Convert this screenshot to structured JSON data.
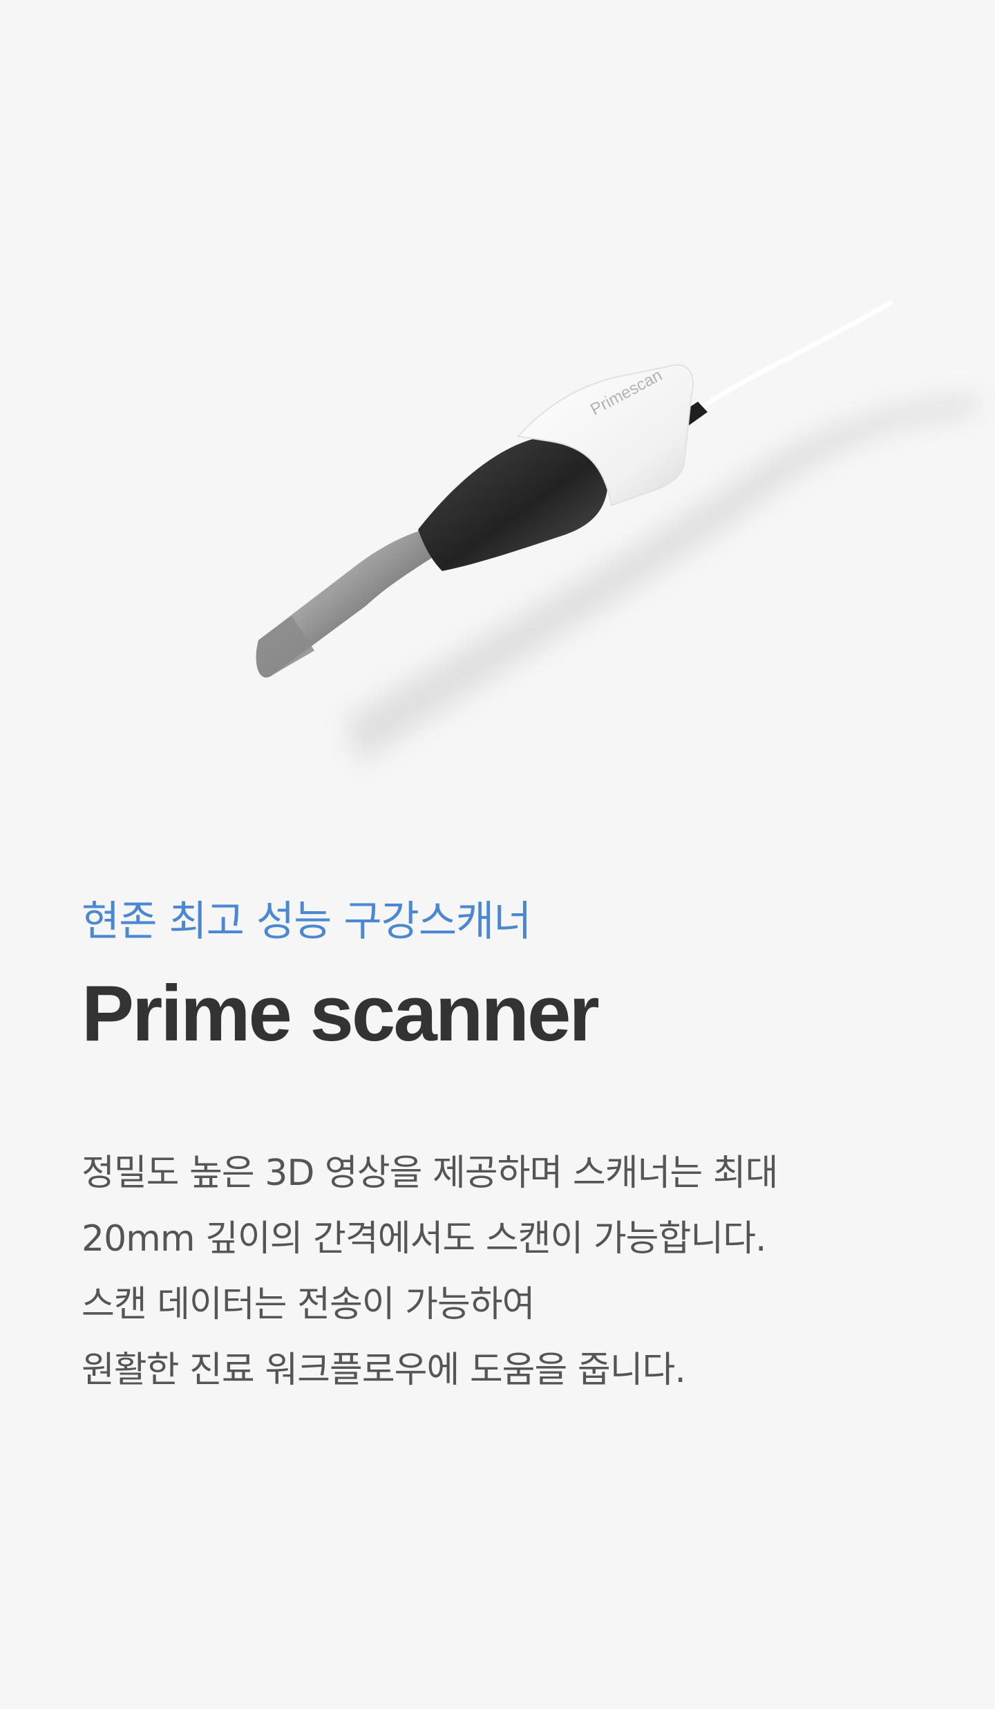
{
  "product": {
    "image_name": "intraoral-scanner-image",
    "brand_label": "Primescan",
    "colors": {
      "body": "#ffffff",
      "grip": "#2f2f2f",
      "tip": "#a6a6a6",
      "shadow": "#d9d9d9"
    }
  },
  "intro": {
    "subtitle": "현존 최고 성능 구강스캐너",
    "title": "Prime scanner",
    "description_lines": [
      "정밀도 높은 3D 영상을 제공하며 스캐너는 최대",
      "20mm 깊이의 간격에서도 스캔이 가능합니다.",
      "스캔 데이터는 전송이 가능하여",
      "원활한 진료 워크플로우에 도움을 줍니다."
    ]
  },
  "colors": {
    "background": "#f6f6f6",
    "accent": "#4b88d1",
    "title": "#333333",
    "body_text": "#555555"
  }
}
